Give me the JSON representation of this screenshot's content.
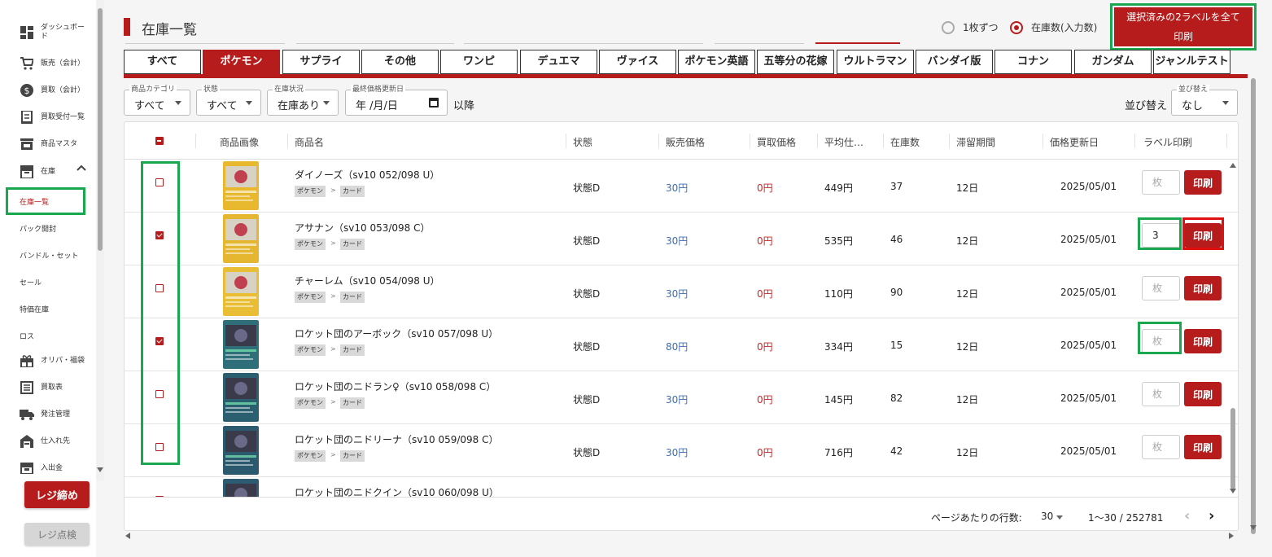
{
  "sidebar": {
    "items": [
      {
        "label": "ダッシュボード",
        "icon": "dashboard-icon"
      },
      {
        "label": "販売（会計）",
        "icon": "cart-icon"
      },
      {
        "label": "買取（会計）",
        "icon": "dollar-icon"
      },
      {
        "label": "買取受付一覧",
        "icon": "receipt-icon"
      },
      {
        "label": "商品マスタ",
        "icon": "store-icon"
      },
      {
        "label": "在庫",
        "icon": "inventory-icon"
      }
    ],
    "sub_items": [
      "在庫一覧",
      "パック開封",
      "バンドル・セット",
      "セール",
      "特価在庫",
      "ロス"
    ],
    "items2": [
      {
        "label": "オリパ・福袋",
        "icon": "gift-icon"
      },
      {
        "label": "買取表",
        "icon": "list-icon"
      },
      {
        "label": "発注管理",
        "icon": "truck-icon"
      },
      {
        "label": "仕入れ先",
        "icon": "warehouse-icon"
      },
      {
        "label": "入出金",
        "icon": "cash-icon"
      }
    ],
    "close_register": "レジ締め",
    "check_register": "レジ点検"
  },
  "header": {
    "title": "在庫一覧",
    "radio_one": "1枚ずつ",
    "radio_stock": "在庫数(入力数)",
    "print_all_line1": "選択済みの2ラベルを全て",
    "print_all_line2": "印刷"
  },
  "tabs": [
    "すべて",
    "ポケモン",
    "サプライ",
    "その他",
    "ワンピ",
    "デュエマ",
    "ヴァイス",
    "ポケモン英語",
    "五等分の花嫁",
    "ウルトラマン",
    "バンダイ版",
    "コナン",
    "ガンダム",
    "ジャンルテスト"
  ],
  "active_tab": 1,
  "filters": {
    "category_label": "商品カテゴリ",
    "category_value": "すべて",
    "condition_label": "状態",
    "condition_value": "すべて",
    "stock_label": "在庫状況",
    "stock_value": "在庫あり",
    "date_label": "最終価格更新日",
    "date_value": "年 /月/日",
    "after": "以降",
    "sort_text": "並び替え",
    "sort_label": "並び替え",
    "sort_value": "なし"
  },
  "table": {
    "headers": [
      "商品画像",
      "商品名",
      "状態",
      "販売価格",
      "買取価格",
      "平均仕…",
      "在庫数",
      "滞留期間",
      "価格更新日",
      "ラベル印刷"
    ],
    "tag1": "ポケモン",
    "tag_sep": ">",
    "tag2": "カード",
    "qty_placeholder": "枚",
    "print_label": "印刷",
    "rows": [
      {
        "name": "ダイノーズ（sv10 052/098 U）",
        "cond": "状態D",
        "sell": "30円",
        "buy": "0円",
        "avg": "449円",
        "stock": "37",
        "days": "12日",
        "date": "2025/05/01",
        "checked": false,
        "qty": "",
        "color": "#e8b92e"
      },
      {
        "name": "アサナン（sv10 053/098 C）",
        "cond": "状態D",
        "sell": "30円",
        "buy": "0円",
        "avg": "535円",
        "stock": "46",
        "days": "12日",
        "date": "2025/05/01",
        "checked": true,
        "qty": "3",
        "color": "#e5b730"
      },
      {
        "name": "チャーレム（sv10 054/098 U）",
        "cond": "状態D",
        "sell": "30円",
        "buy": "0円",
        "avg": "110円",
        "stock": "90",
        "days": "12日",
        "date": "2025/05/01",
        "checked": false,
        "qty": "",
        "color": "#e9bd34"
      },
      {
        "name": "ロケット団のアーボック（sv10 057/098 U）",
        "cond": "状態D",
        "sell": "80円",
        "buy": "0円",
        "avg": "334円",
        "stock": "15",
        "days": "12日",
        "date": "2025/05/01",
        "checked": true,
        "qty": "",
        "color": "#2f6f7a"
      },
      {
        "name": "ロケット団のニドラン♀（sv10 058/098 C）",
        "cond": "状態D",
        "sell": "30円",
        "buy": "0円",
        "avg": "145円",
        "stock": "82",
        "days": "12日",
        "date": "2025/05/01",
        "checked": false,
        "qty": "",
        "color": "#2a5f70"
      },
      {
        "name": "ロケット団のニドリーナ（sv10 059/098 C）",
        "cond": "状態D",
        "sell": "30円",
        "buy": "0円",
        "avg": "716円",
        "stock": "42",
        "days": "12日",
        "date": "2025/05/01",
        "checked": false,
        "qty": "",
        "color": "#2b5a6e"
      },
      {
        "name": "ロケット団のニドクイン（sv10 060/098 U）",
        "cond": "",
        "sell": "",
        "buy": "",
        "avg": "",
        "stock": "",
        "days": "",
        "date": "",
        "checked": false,
        "qty": "",
        "color": "#2d5b72"
      }
    ]
  },
  "pagination": {
    "rows_per_page_label": "ページあたりの行数:",
    "rows_per_page": "30",
    "range": "1〜30 / 252781"
  },
  "colors": {
    "accent": "#b71c1c",
    "highlight_green": "#1aa84f",
    "highlight_red": "#e01010"
  }
}
